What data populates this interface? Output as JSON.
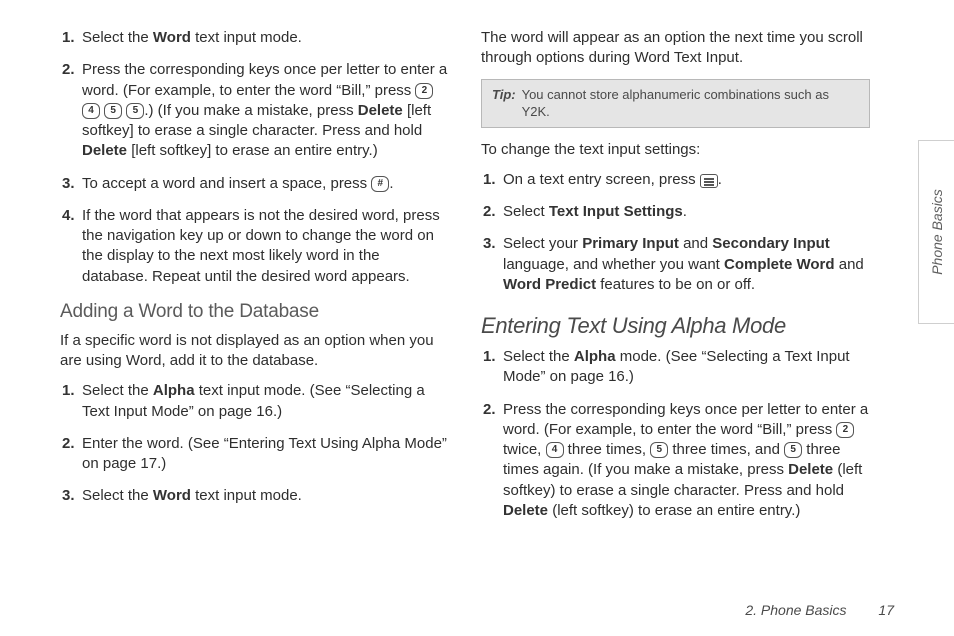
{
  "side_tab": "Phone Basics",
  "left": {
    "list1": [
      {
        "num": "1.",
        "pre": "Select the ",
        "bold1": "Word",
        "post1": " text input mode."
      },
      {
        "num": "2.",
        "pre": "Press the corresponding keys once per letter to enter a word. (For example, to enter the word “Bill,” press ",
        "keys": [
          "2",
          "4",
          "5",
          "5"
        ],
        "mid": ".) (If you make a mistake, press ",
        "bold1": "Delete",
        "post1": " [left softkey] to erase a single character. Press and hold ",
        "bold2": "Delete",
        "post2": " [left softkey] to erase an entire entry.)"
      },
      {
        "num": "3.",
        "text": "To accept a word and insert a space, press ",
        "key_end": "#",
        "period": "."
      },
      {
        "num": "4.",
        "text": "If the word that appears is not the desired word, press the navigation key up or down to change the word on the display to the next most likely word in the database. Repeat until the desired word appears."
      }
    ],
    "subhead": "Adding a Word to the Database",
    "para1": "If a specific word is not displayed as an option when you are using Word, add it to the database.",
    "list2": [
      {
        "num": "1.",
        "pre": "Select the ",
        "bold1": "Alpha",
        "post1": " text input mode. (See “Selecting a Text Input Mode” on page 16.)"
      },
      {
        "num": "2.",
        "text": "Enter the word. (See “Entering Text Using Alpha Mode” on page 17.)"
      },
      {
        "num": "3.",
        "pre": "Select the ",
        "bold1": "Word",
        "post1": " text input mode."
      }
    ]
  },
  "right": {
    "intro": "The word will appear as an option the next time you scroll through options during Word Text Input.",
    "tip_label": "Tip:",
    "tip_text": "You cannot store alphanumeric combinations such as Y2K.",
    "settings_heading": "To change the text input settings:",
    "settings_list": [
      {
        "num": "1.",
        "text": "On a text entry screen, press ",
        "menu_icon": true,
        "period": "."
      },
      {
        "num": "2.",
        "pre": "Select ",
        "bold1": "Text Input Settings",
        "post1": "."
      },
      {
        "num": "3.",
        "pre": "Select your ",
        "bold1": "Primary Input",
        "mid1": " and ",
        "bold2": "Secondary Input",
        "post1": " language, and whether you want ",
        "bold3": "Complete Word",
        "mid2": " and ",
        "bold4": "Word Predict",
        "post2": " features to be on or off."
      }
    ],
    "heading2": "Entering Text Using Alpha Mode",
    "alpha_list": [
      {
        "num": "1.",
        "pre": "Select the ",
        "bold1": "Alpha",
        "post1": " mode. (See “Selecting a Text Input Mode” on page 16.)"
      },
      {
        "num": "2.",
        "pre": "Press the corresponding keys once per letter to enter a word. (For example, to enter the word “Bill,” press  ",
        "seg": [
          {
            "key": "2"
          },
          {
            "t": " twice, "
          },
          {
            "key": "4"
          },
          {
            "t": " three times, "
          },
          {
            "key": "5"
          },
          {
            "t": " three times, and "
          },
          {
            "key": "5"
          },
          {
            "t": " three times again. (If you make a mistake, press "
          }
        ],
        "bold1": "Delete",
        "post1": " (left softkey) to erase a single character. Press and hold ",
        "bold2": "Delete",
        "post2": " (left softkey) to erase an entire entry.)"
      }
    ]
  },
  "footer": {
    "chapter": "2. Phone Basics",
    "page": "17"
  }
}
